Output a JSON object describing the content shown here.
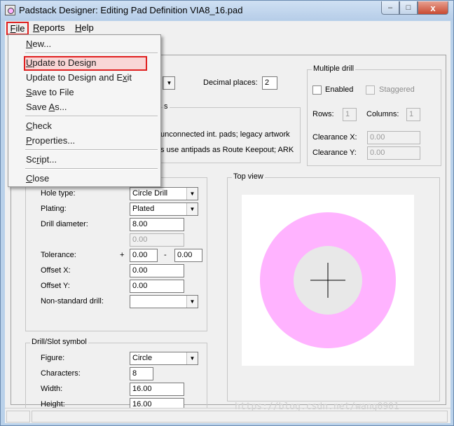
{
  "window": {
    "title": "Padstack Designer: Editing Pad Definition VIA8_16.pad",
    "minimize_glyph": "–",
    "maximize_glyph": "□",
    "close_glyph": "x"
  },
  "menubar": {
    "items": [
      {
        "label": "File",
        "mnemonic": "F",
        "rest": "ile"
      },
      {
        "label": "Reports",
        "mnemonic": "R",
        "rest": "eports"
      },
      {
        "label": "Help",
        "mnemonic": "H",
        "rest": "elp"
      }
    ]
  },
  "file_menu": {
    "new": {
      "pre": "",
      "m": "N",
      "post": "ew..."
    },
    "update_to_design": {
      "pre": "",
      "m": "U",
      "post": "pdate to Design"
    },
    "update_to_design_exit": {
      "pre": "Update to Design and E",
      "m": "x",
      "post": "it"
    },
    "save_to_file": {
      "pre": "",
      "m": "S",
      "post": "ave to File"
    },
    "save_as": {
      "pre": "Save ",
      "m": "A",
      "post": "s..."
    },
    "check": {
      "pre": "",
      "m": "C",
      "post": "heck"
    },
    "properties": {
      "pre": "",
      "m": "P",
      "post": "roperties..."
    },
    "script": {
      "pre": "Sc",
      "m": "r",
      "post": "ipt..."
    },
    "close": {
      "pre": "",
      "m": "C",
      "post": "lose"
    }
  },
  "units": {
    "decimal_places_label": "Decimal places:",
    "decimal_places_value": "2"
  },
  "usage_options": {
    "title_tail": "s",
    "line1": "unconnected int. pads; legacy artwork",
    "line2": "s use antipads as Route Keepout; ARK"
  },
  "multiple_drill": {
    "title": "Multiple drill",
    "enabled_label": "Enabled",
    "staggered_label": "Staggered",
    "rows_label": "Rows:",
    "rows_value": "1",
    "columns_label": "Columns:",
    "columns_value": "1",
    "clearance_x_label": "Clearance X:",
    "clearance_x_value": "0.00",
    "clearance_y_label": "Clearance Y:",
    "clearance_y_value": "0.00"
  },
  "drill": {
    "hole_type_label": "Hole type:",
    "hole_type_value": "Circle Drill",
    "plating_label": "Plating:",
    "plating_value": "Plated",
    "drill_diameter_label": "Drill diameter:",
    "drill_diameter_value": "8.00",
    "drill_second_value": "0.00",
    "tolerance_label": "Tolerance:",
    "tolerance_plus": "+",
    "tolerance_plus_value": "0.00",
    "tolerance_minus": "-",
    "tolerance_minus_value": "0.00",
    "offset_x_label": "Offset X:",
    "offset_x_value": "0.00",
    "offset_y_label": "Offset Y:",
    "offset_y_value": "0.00",
    "non_standard_label": "Non-standard drill:",
    "non_standard_value": ""
  },
  "drill_symbol": {
    "title": "Drill/Slot symbol",
    "figure_label": "Figure:",
    "figure_value": "Circle",
    "characters_label": "Characters:",
    "characters_value": "8",
    "width_label": "Width:",
    "width_value": "16.00",
    "height_label": "Height:",
    "height_value": "16.00"
  },
  "top_view": {
    "title": "Top view",
    "pad_color": "#ffb3ff",
    "hole_color": "#e8e8e8",
    "crosshair_color": "#000000"
  },
  "watermark": "https://blog.csdn.net/wang0901",
  "icons": {
    "combo_arrow": "▼"
  },
  "colors": {
    "highlight_border": "#e02020",
    "highlight_fill": "#f9d6d6"
  }
}
